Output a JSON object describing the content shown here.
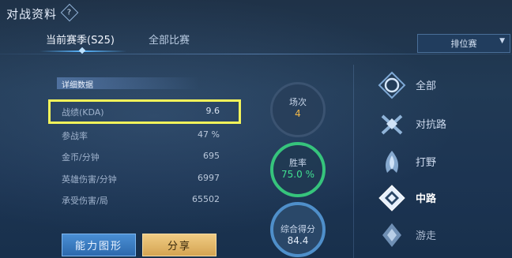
{
  "header": {
    "title": "对战资料",
    "help_icon": "?"
  },
  "tabs": [
    {
      "label": "当前赛季(S25)",
      "active": true
    },
    {
      "label": "全部比赛",
      "active": false
    }
  ],
  "mode_select": {
    "value": "排位赛"
  },
  "details": {
    "heading": "详细数据",
    "rows": [
      {
        "label": "战绩(KDA)",
        "value": "9.6"
      },
      {
        "label": "参战率",
        "value": "47 %"
      },
      {
        "label": "金币/分钟",
        "value": "695"
      },
      {
        "label": "英雄伤害/分钟",
        "value": "6997"
      },
      {
        "label": "承受伤害/局",
        "value": "65502"
      }
    ]
  },
  "stats": {
    "games": {
      "label": "场次",
      "value": "4"
    },
    "win_rate": {
      "label": "胜率",
      "value": "75.0 %"
    },
    "score": {
      "label": "综合得分",
      "value": "84.4"
    }
  },
  "buttons": {
    "ability": "能力图形",
    "share": "分享"
  },
  "positions": [
    {
      "label": "全部",
      "icon": "all-lanes-icon"
    },
    {
      "label": "对抗路",
      "icon": "top-lane-icon"
    },
    {
      "label": "打野",
      "icon": "jungle-icon"
    },
    {
      "label": "中路",
      "icon": "mid-lane-icon",
      "active": true
    },
    {
      "label": "游走",
      "icon": "roam-icon"
    }
  ],
  "colors": {
    "highlight": "#f3f35a",
    "win_ring": "#36c47c",
    "score_ring": "#4f8fca",
    "games_value": "#f0b84a",
    "share_button": "#e1b465",
    "ability_button": "#3b7cc2"
  }
}
